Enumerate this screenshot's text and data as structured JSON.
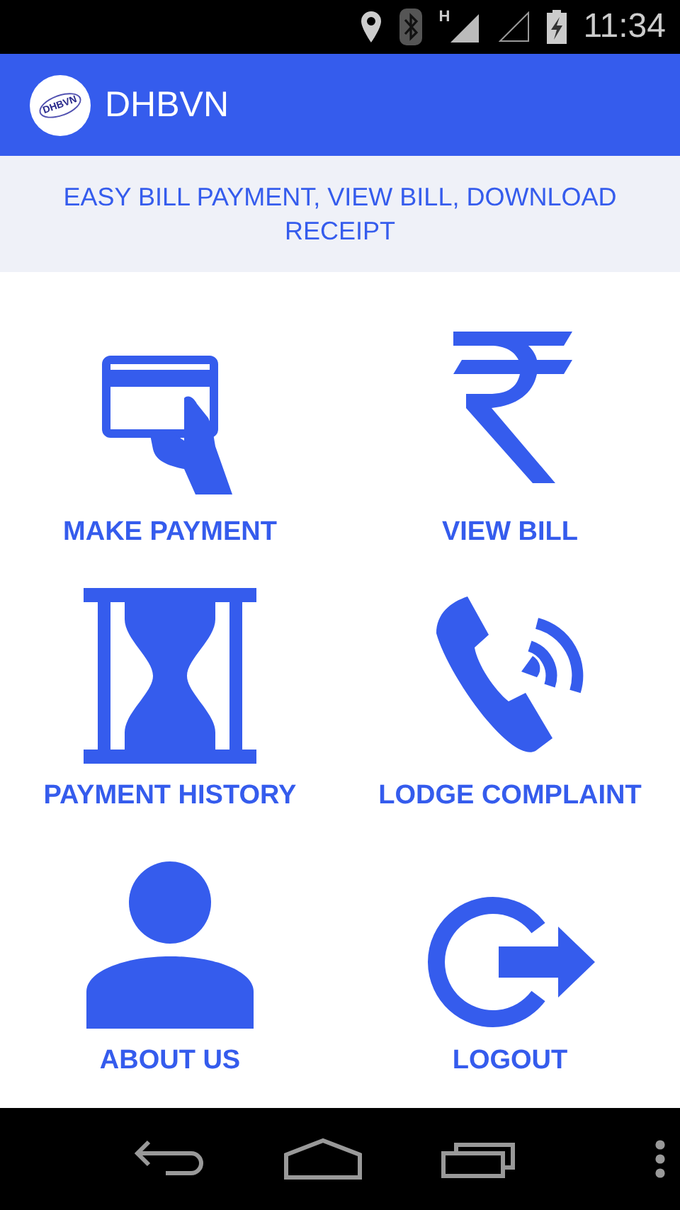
{
  "status_bar": {
    "time": "11:34",
    "network_label": "H"
  },
  "app_bar": {
    "logo_text": "DHBVN",
    "title": "DHBVN"
  },
  "banner": "EASY BILL PAYMENT, VIEW BILL, DOWNLOAD RECEIPT",
  "tiles": [
    {
      "kind": "card",
      "label": "MAKE PAYMENT"
    },
    {
      "kind": "rupee",
      "label": "VIEW BILL"
    },
    {
      "kind": "hourglass",
      "label": "PAYMENT HISTORY"
    },
    {
      "kind": "phone",
      "label": "LODGE COMPLAINT"
    },
    {
      "kind": "person",
      "label": "ABOUT US"
    },
    {
      "kind": "logout",
      "label": "LOGOUT"
    }
  ]
}
